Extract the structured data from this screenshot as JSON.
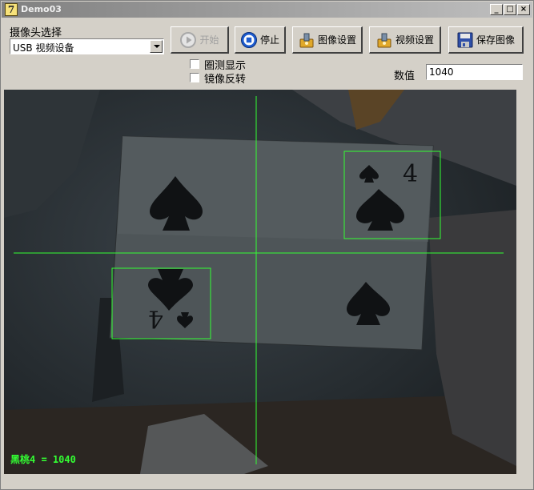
{
  "window": {
    "title": "Demo03",
    "minimize_glyph": "_",
    "maximize_glyph": "□",
    "close_glyph": "×"
  },
  "camera": {
    "label": "摄像头选择",
    "selected": "USB 视频设备"
  },
  "toolbar": {
    "start_label": "开始",
    "stop_label": "停止",
    "image_settings_label": "图像设置",
    "video_settings_label": "视频设置",
    "save_image_label": "保存图像"
  },
  "options": {
    "circle_detect_label": "圈测显示",
    "mirror_flip_label": "镜像反转"
  },
  "value": {
    "label": "数值",
    "current": "1040"
  },
  "video": {
    "overlay_text": "黑桃4 = 1040",
    "overlay_color": "#33ff33",
    "card": {
      "rank": "4",
      "suit": "spade-icon"
    }
  },
  "colors": {
    "window_bg": "#d4d0c8",
    "detection_green": "#33ff33",
    "stop_icon_blue": "#1e5ccf"
  }
}
